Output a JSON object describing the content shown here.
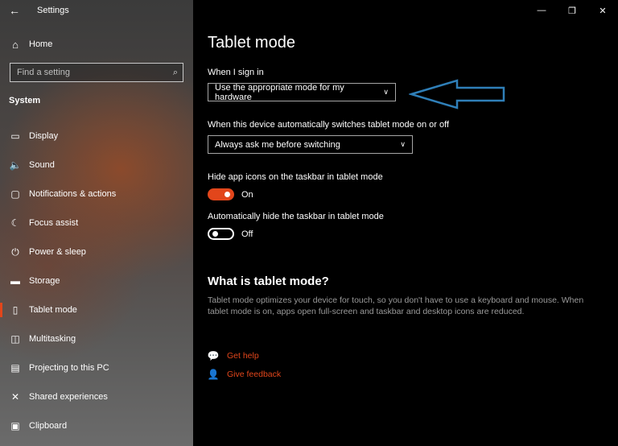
{
  "window": {
    "title": "Settings",
    "controls": [
      "—",
      "❐",
      "✕"
    ]
  },
  "sidebar": {
    "home_label": "Home",
    "search_placeholder": "Find a setting",
    "section_label": "System",
    "items": [
      {
        "label": "Display",
        "icon": "display-icon",
        "glyph": "▭"
      },
      {
        "label": "Sound",
        "icon": "speaker-icon",
        "glyph": "🔈"
      },
      {
        "label": "Notifications & actions",
        "icon": "notification-icon",
        "glyph": "▢"
      },
      {
        "label": "Focus assist",
        "icon": "moon-icon",
        "glyph": "☾"
      },
      {
        "label": "Power & sleep",
        "icon": "power-icon",
        "glyph": "⏻"
      },
      {
        "label": "Storage",
        "icon": "storage-icon",
        "glyph": "▬"
      },
      {
        "label": "Tablet mode",
        "icon": "tablet-icon",
        "glyph": "▯"
      },
      {
        "label": "Multitasking",
        "icon": "multitasking-icon",
        "glyph": "◫"
      },
      {
        "label": "Projecting to this PC",
        "icon": "projector-icon",
        "glyph": "▤"
      },
      {
        "label": "Shared experiences",
        "icon": "shared-icon",
        "glyph": "✕"
      },
      {
        "label": "Clipboard",
        "icon": "clipboard-icon",
        "glyph": "▣"
      }
    ]
  },
  "main": {
    "title": "Tablet mode",
    "sign_in_label": "When I sign in",
    "sign_in_value": "Use the appropriate mode for my hardware",
    "switch_label": "When this device automatically switches tablet mode on or off",
    "switch_value": "Always ask me before switching",
    "hide_icons_label": "Hide app icons on the taskbar in tablet mode",
    "hide_icons_state": "On",
    "hide_taskbar_label": "Automatically hide the taskbar in tablet mode",
    "hide_taskbar_state": "Off",
    "what_heading": "What is tablet mode?",
    "what_text": "Tablet mode optimizes your device for touch, so you don't have to use a keyboard and mouse. When tablet mode is on, apps open full-screen and taskbar and desktop icons are reduced.",
    "get_help": "Get help",
    "give_feedback": "Give feedback"
  },
  "colors": {
    "accent": "#e2461b",
    "annotation_arrow": "#2f7fb8"
  }
}
